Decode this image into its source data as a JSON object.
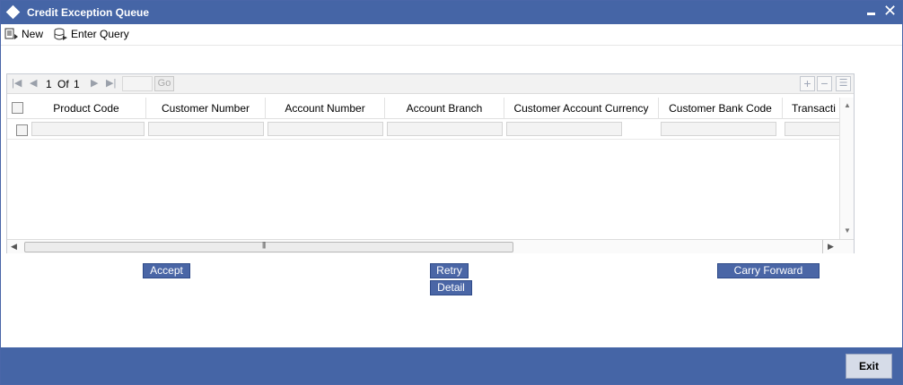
{
  "window": {
    "title": "Credit Exception Queue"
  },
  "toolbar": {
    "new_label": "New",
    "enter_query_label": "Enter Query"
  },
  "pager": {
    "current_page": "1",
    "of_label": "Of",
    "total_pages": "1",
    "go_label": "Go"
  },
  "table": {
    "columns": [
      "Product Code",
      "Customer Number",
      "Account Number",
      "Account Branch",
      "Customer Account Currency",
      "Customer Bank Code",
      "Transacti"
    ]
  },
  "actions": {
    "accept_label": "Accept",
    "retry_label": "Retry",
    "detail_label": "Detail",
    "carry_forward_label": "Carry Forward"
  },
  "footer": {
    "exit_label": "Exit"
  },
  "colors": {
    "title_bar": "#4565a6",
    "button": "#4a66a6"
  }
}
